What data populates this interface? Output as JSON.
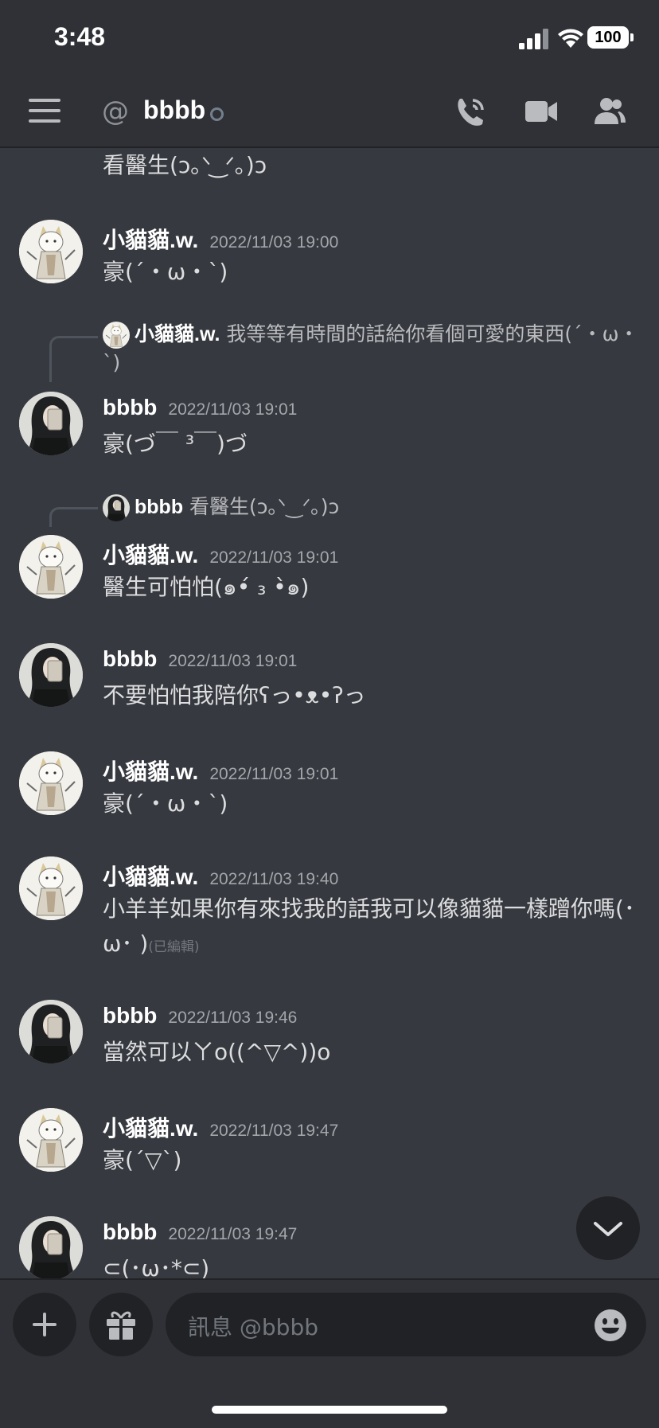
{
  "status_bar": {
    "time": "3:48",
    "battery": "100"
  },
  "header": {
    "at_symbol": "@",
    "channel_name": "bbbb"
  },
  "messages": [
    {
      "content": "看醫生(ᴐ｡ᐠ ͜ ᐟ｡)ᴐ"
    },
    {
      "user": "小貓貓.w.",
      "time": "2022/11/03 19:00",
      "content": "豪(´・ω・`)"
    },
    {
      "reply_user": "小貓貓.w.",
      "reply_text": "我等等有時間的話給你看個可愛的東西(´・ω・`)",
      "user": "bbbb",
      "time": "2022/11/03 19:01",
      "content": "豪(づ￣ ³￣)づ"
    },
    {
      "reply_user": "bbbb",
      "reply_text": "看醫生(ᴐ｡ᐠ‿ᐟ｡)ᴐ",
      "user": "小貓貓.w.",
      "time": "2022/11/03 19:01",
      "content": "醫生可怕怕(๑•́ ₃ •̀๑)"
    },
    {
      "user": "bbbb",
      "time": "2022/11/03 19:01",
      "content": "不要怕怕我陪你ʕっ•ᴥ•ʔっ"
    },
    {
      "user": "小貓貓.w.",
      "time": "2022/11/03 19:01",
      "content": "豪(´・ω・`)"
    },
    {
      "user": "小貓貓.w.",
      "time": "2022/11/03 19:40",
      "content": "小羊羊如果你有來找我的話我可以像貓貓一樣蹭你嗎(･ω･ )",
      "edited": "(已編輯)"
    },
    {
      "user": "bbbb",
      "time": "2022/11/03 19:46",
      "content": "當然可以ㄚo((^▽^))o"
    },
    {
      "user": "小貓貓.w.",
      "time": "2022/11/03 19:47",
      "content": "豪(´▽`)"
    },
    {
      "user": "bbbb",
      "time": "2022/11/03 19:47",
      "content": "⊂(･ω･*⊂)"
    }
  ],
  "composer": {
    "placeholder": "訊息 @bbbb"
  },
  "icons": {
    "menu": "hamburger-icon",
    "call": "phone-call-icon",
    "video": "video-camera-icon",
    "members": "members-icon",
    "scroll": "chevron-down-icon",
    "attach": "plus-icon",
    "gift": "gift-icon",
    "emoji": "emoji-icon"
  },
  "colors": {
    "background": "#36393f",
    "header": "#2f3136",
    "input": "#202225",
    "username": "#ffffff",
    "timestamp": "#a3a6aa"
  }
}
